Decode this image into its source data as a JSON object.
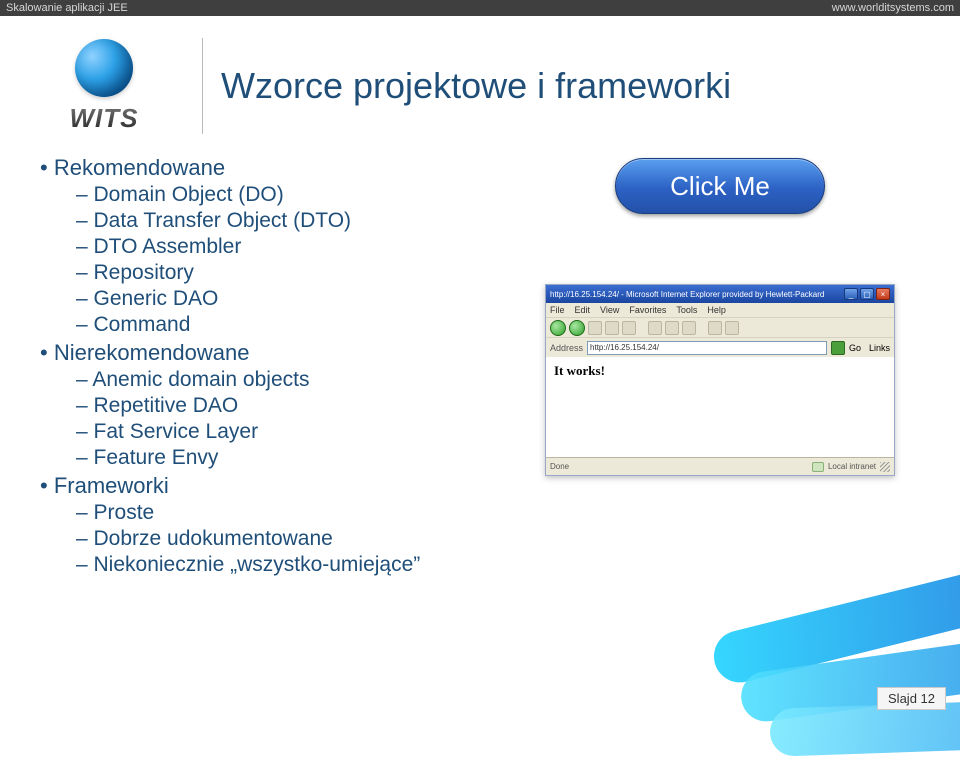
{
  "topbar": {
    "left": "Skalowanie aplikacji JEE",
    "right": "www.worlditsystems.com"
  },
  "logo_text": "WITS",
  "title": "Wzorce projektowe i frameworki",
  "list": {
    "recommended": {
      "label": "Rekomendowane",
      "items": [
        "Domain Object (DO)",
        "Data Transfer Object (DTO)",
        "DTO Assembler",
        "Repository",
        "Generic DAO",
        "Command"
      ]
    },
    "not_recommended": {
      "label": "Nierekomendowane",
      "items": [
        "Anemic domain objects",
        "Repetitive DAO",
        "Fat Service Layer",
        "Feature Envy"
      ]
    },
    "frameworks": {
      "label": "Frameworki",
      "items": [
        "Proste",
        "Dobrze udokumentowane",
        "Niekoniecznie „wszystko-umiejące”"
      ]
    }
  },
  "click_button": "Click Me",
  "browser": {
    "title": "http://16.25.154.24/ - Microsoft Internet Explorer provided by Hewlett-Packard",
    "menus": [
      "File",
      "Edit",
      "View",
      "Favorites",
      "Tools",
      "Help"
    ],
    "address_label": "Address",
    "address_value": "http://16.25.154.24/",
    "go": "Go",
    "links": "Links",
    "body": "It works!",
    "status_left": "Done",
    "status_right": "Local intranet"
  },
  "footer": {
    "slide": "Slajd 12"
  }
}
